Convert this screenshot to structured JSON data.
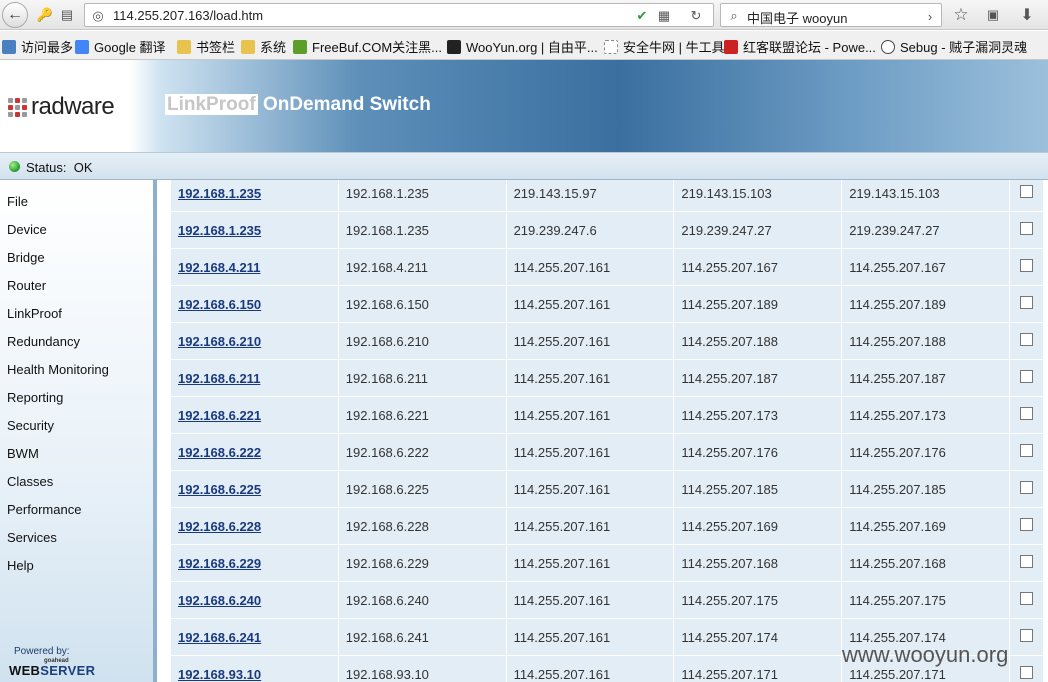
{
  "browser": {
    "url": "114.255.207.163/load.htm",
    "search_query": "中国电子 wooyun"
  },
  "bookmarks": [
    {
      "label": "访问最多",
      "color": "#4a7fc0"
    },
    {
      "label": "Google 翻译",
      "color": "#4285f4"
    },
    {
      "label": "书签栏",
      "color": "#e8c34f"
    },
    {
      "label": "系统",
      "color": "#e8c34f"
    },
    {
      "label": "FreeBuf.COM关注黑...",
      "color": "#5c9e2a"
    },
    {
      "label": "WooYun.org | 自由平...",
      "color": "#222222"
    },
    {
      "label": "安全牛网 | 牛工具",
      "color": "#888888"
    },
    {
      "label": "红客联盟论坛 - Powe...",
      "color": "#cc2222"
    },
    {
      "label": "Sebug - 贼子漏洞灵魂",
      "color": "#444444"
    }
  ],
  "header": {
    "logo": "radware",
    "title_highlight": "LinkProof",
    "title_rest": " OnDemand Switch"
  },
  "status": {
    "label": "Status:",
    "value": "OK"
  },
  "sidebar": {
    "items": [
      "File",
      "Device",
      "Bridge",
      "Router",
      "LinkProof",
      "Redundancy",
      "Health Monitoring",
      "Reporting",
      "Security",
      "BWM",
      "Classes",
      "Performance",
      "Services",
      "Help"
    ],
    "powered_by": "Powered by:",
    "goahead": "goahead",
    "web": "WEB",
    "server": "SERVER"
  },
  "table": {
    "rows": [
      [
        "192.168.1.235",
        "192.168.1.235",
        "219.143.15.97",
        "219.143.15.103",
        "219.143.15.103"
      ],
      [
        "192.168.1.235",
        "192.168.1.235",
        "219.239.247.6",
        "219.239.247.27",
        "219.239.247.27"
      ],
      [
        "192.168.4.211",
        "192.168.4.211",
        "114.255.207.161",
        "114.255.207.167",
        "114.255.207.167"
      ],
      [
        "192.168.6.150",
        "192.168.6.150",
        "114.255.207.161",
        "114.255.207.189",
        "114.255.207.189"
      ],
      [
        "192.168.6.210",
        "192.168.6.210",
        "114.255.207.161",
        "114.255.207.188",
        "114.255.207.188"
      ],
      [
        "192.168.6.211",
        "192.168.6.211",
        "114.255.207.161",
        "114.255.207.187",
        "114.255.207.187"
      ],
      [
        "192.168.6.221",
        "192.168.6.221",
        "114.255.207.161",
        "114.255.207.173",
        "114.255.207.173"
      ],
      [
        "192.168.6.222",
        "192.168.6.222",
        "114.255.207.161",
        "114.255.207.176",
        "114.255.207.176"
      ],
      [
        "192.168.6.225",
        "192.168.6.225",
        "114.255.207.161",
        "114.255.207.185",
        "114.255.207.185"
      ],
      [
        "192.168.6.228",
        "192.168.6.228",
        "114.255.207.161",
        "114.255.207.169",
        "114.255.207.169"
      ],
      [
        "192.168.6.229",
        "192.168.6.229",
        "114.255.207.161",
        "114.255.207.168",
        "114.255.207.168"
      ],
      [
        "192.168.6.240",
        "192.168.6.240",
        "114.255.207.161",
        "114.255.207.175",
        "114.255.207.175"
      ],
      [
        "192.168.6.241",
        "192.168.6.241",
        "114.255.207.161",
        "114.255.207.174",
        "114.255.207.174"
      ],
      [
        "192.168.93.10",
        "192.168.93.10",
        "114.255.207.161",
        "114.255.207.171",
        "114.255.207.171"
      ]
    ]
  },
  "watermark": "www.wooyun.org"
}
